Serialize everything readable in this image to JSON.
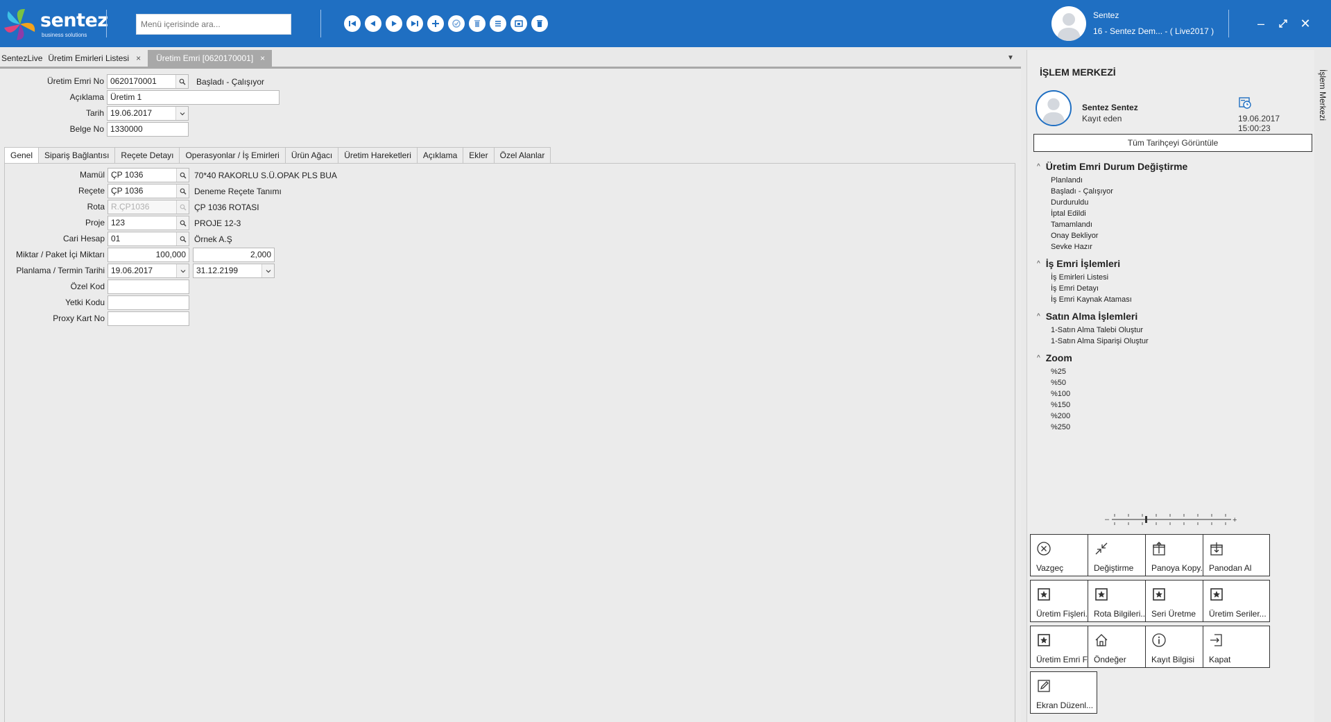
{
  "header": {
    "logo_word": "sentez",
    "logo_sub": "business solutions",
    "search_placeholder": "Menü içerisinde ara...",
    "user_name": "Sentez",
    "user_company": "16 - Sentez Dem... - ( Live2017 )"
  },
  "tabs": [
    {
      "label": "SentezLive"
    },
    {
      "label": "Üretim Emirleri Listesi"
    },
    {
      "label": "Üretim Emri [0620170001]"
    }
  ],
  "tab_close": "×",
  "form": {
    "order_no_label": "Üretim Emri No",
    "order_no": "0620170001",
    "status": "Başladı - Çalışıyor",
    "description_label": "Açıklama",
    "description": "Üretim 1",
    "date_label": "Tarih",
    "date": "19.06.2017",
    "doc_no_label": "Belge No",
    "doc_no": "1330000"
  },
  "form_tabs": [
    "Genel",
    "Sipariş Bağlantısı",
    "Reçete Detayı",
    "Operasyonlar / İş Emirleri",
    "Ürün Ağacı",
    "Üretim Hareketleri",
    "Açıklama",
    "Ekler",
    "Özel Alanlar"
  ],
  "general": {
    "product_label": "Mamül",
    "product": "ÇP 1036",
    "product_desc": "70*40 RAKORLU S.Ü.OPAK PLS BUA",
    "recipe_label": "Reçete",
    "recipe": "ÇP 1036",
    "recipe_desc": "Deneme Reçete Tanımı",
    "route_label": "Rota",
    "route": "R.ÇP1036",
    "route_desc": "ÇP 1036 ROTASI",
    "project_label": "Proje",
    "project": "123",
    "project_desc": "PROJE 12-3",
    "account_label": "Cari Hesap",
    "account": "01",
    "account_desc": "Örnek A.Ş",
    "qty_label": "Miktar / Paket İçi Miktarı",
    "qty": "100,000",
    "pack_qty": "2,000",
    "plan_label": "Planlama / Termin Tarihi",
    "plan_date": "19.06.2017",
    "due_date": "31.12.2199",
    "special_code_label": "Özel Kod",
    "special_code": "",
    "auth_code_label": "Yetki Kodu",
    "auth_code": "",
    "proxy_label": "Proxy Kart No",
    "proxy": ""
  },
  "panel": {
    "title": "İŞLEM MERKEZİ",
    "vertical_tab": "İşlem Merkezi",
    "user": "Sentez Sentez",
    "role": "Kayıt eden",
    "date": "19.06.2017 15:00:23",
    "history_btn": "Tüm Tarihçeyi Görüntüle",
    "sections": [
      {
        "title": "Üretim Emri Durum Değiştirme",
        "items": [
          "Planlandı",
          "Başladı - Çalışıyor",
          "Durduruldu",
          "İptal Edildi",
          "Tamamlandı",
          "Onay Bekliyor",
          "Sevke Hazır"
        ]
      },
      {
        "title": "İş Emri İşlemleri",
        "items": [
          "İş Emirleri Listesi",
          "İş Emri Detayı",
          "İş Emri Kaynak Ataması"
        ]
      },
      {
        "title": "Satın Alma İşlemleri",
        "items": [
          "1-Satın Alma Talebi Oluştur",
          "1-Satın Alma Siparişi Oluştur"
        ]
      },
      {
        "title": "Zoom",
        "items": [
          "%25",
          "%50",
          "%100",
          "%150",
          "%200",
          "%250"
        ]
      }
    ],
    "actions": [
      {
        "label": "Vazgeç",
        "icon": "cancel-circle-icon"
      },
      {
        "label": "Değiştirme",
        "icon": "collapse-arrows-icon"
      },
      {
        "label": "Panoya Kopy...",
        "icon": "clipboard-up-icon"
      },
      {
        "label": "Panodan Al",
        "icon": "clipboard-down-icon"
      },
      {
        "label": "Üretim Fişleri...",
        "icon": "star-box-icon"
      },
      {
        "label": "Rota Bilgileri...",
        "icon": "star-box-icon"
      },
      {
        "label": "Seri Üretme",
        "icon": "star-box-icon"
      },
      {
        "label": "Üretim Seriler...",
        "icon": "star-box-icon"
      },
      {
        "label": "Üretim Emri F...",
        "icon": "star-box-icon"
      },
      {
        "label": "Öndeğer",
        "icon": "home-icon"
      },
      {
        "label": "Kayıt Bilgisi",
        "icon": "info-icon"
      },
      {
        "label": "Kapat",
        "icon": "exit-icon"
      },
      {
        "label": "Ekran Düzenl...",
        "icon": "edit-icon"
      }
    ]
  }
}
